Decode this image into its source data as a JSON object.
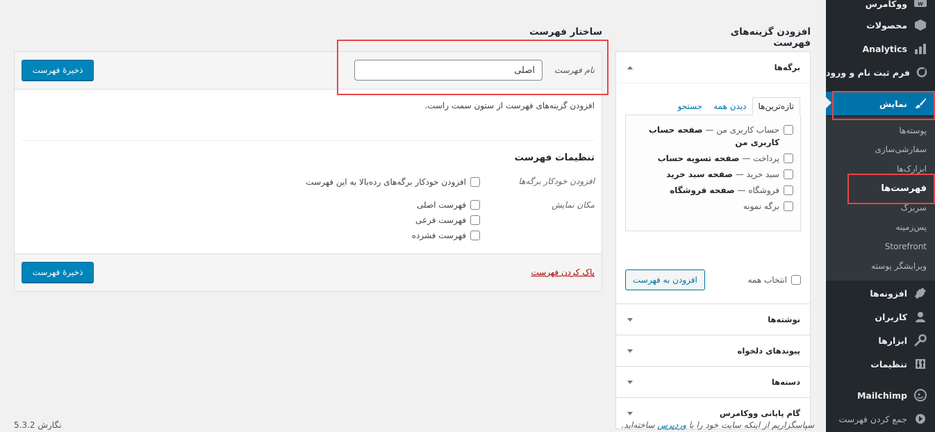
{
  "sidebar": {
    "items": [
      {
        "label": "ووکامرس",
        "icon": "woo-icon",
        "current": false
      },
      {
        "label": "محصولات",
        "icon": "box-icon",
        "current": false
      },
      {
        "label": "Analytics",
        "icon": "bar-chart-icon",
        "current": false
      },
      {
        "label": "فرم ثبت نام و ورود",
        "icon": "circle-icon",
        "current": false
      },
      {
        "label": "نمایش",
        "icon": "paintbrush-icon",
        "current": true
      },
      {
        "label": "افزونه‌ها",
        "icon": "plugin-icon",
        "current": false
      },
      {
        "label": "کاربران",
        "icon": "users-icon",
        "current": false
      },
      {
        "label": "ابزارها",
        "icon": "wrench-icon",
        "current": false
      },
      {
        "label": "تنظیمات",
        "icon": "settings-icon",
        "current": false
      },
      {
        "label": "Mailchimp",
        "icon": "mailchimp-icon",
        "current": false
      },
      {
        "label": "جمع کردن فهرست",
        "icon": "collapse-icon",
        "current": false
      }
    ],
    "submenu": [
      {
        "label": "پوسته‌ها",
        "active": false
      },
      {
        "label": "سفارشی‌سازی",
        "active": false
      },
      {
        "label": "ابزارک‌ها",
        "active": false
      },
      {
        "label": "فهرست‌ها",
        "active": true
      },
      {
        "label": "سربرگ",
        "active": false
      },
      {
        "label": "پس‌زمینه",
        "active": false
      },
      {
        "label": "Storefront",
        "active": false
      },
      {
        "label": "ویرایشگر پوسته",
        "active": false
      }
    ]
  },
  "add_items": {
    "heading": "افزودن گزینه‌های فهرست",
    "pages_section": {
      "title": "برگه‌ها",
      "tabs": [
        "تازه‌ترین‌ها",
        "دیدن همه",
        "جستجو"
      ],
      "items": [
        {
          "prefix": "حساب کاربری من — ",
          "bold": "صفحه حساب کاربری من"
        },
        {
          "prefix": "پرداخت — ",
          "bold": "صفحه تسویه حساب"
        },
        {
          "prefix": "سبد خرید — ",
          "bold": "صفحه سبد خرید"
        },
        {
          "prefix": "فروشگاه — ",
          "bold": "صفحه فروشگاه"
        },
        {
          "prefix": "برگه نمونه",
          "bold": ""
        }
      ],
      "select_all": "انتخاب همه",
      "add_button": "افزودن به فهرست"
    },
    "collapsed_sections": [
      "نوشته‌ها",
      "پیوندهای دلخواه",
      "دسته‌ها",
      "گام پایانی ووکامرس"
    ]
  },
  "menu_structure": {
    "heading": "ساختار فهرست",
    "name_label": "نام فهرست",
    "name_value": "اصلی",
    "save_label": "ذخیرهٔ فهرست",
    "instructions": "افزودن گزینه‌های فهرست از ستون سمت راست.",
    "settings_title": "تنظیمات فهرست",
    "auto_add_label": "افزودن خودکار برگه‌ها",
    "auto_add_option": "افزودن خودکار برگه‌های رده‌بالا به این فهرست",
    "location_label": "مکان نمایش",
    "locations": [
      "فهرست اصلی",
      "فهرست فرعی",
      "فهرست فشرده"
    ],
    "delete_label": "پاک کردن فهرست"
  },
  "footer": {
    "thanks_before": "سپاسگزاریم از اینکه سایت خود را با ",
    "thanks_link": "وردپرس",
    "thanks_after": " ساخته‌اید.",
    "version": "نگارش 5.3.2"
  },
  "colors": {
    "accent": "#0073aa",
    "highlight": "#e8454a",
    "sidebar": "#23282d"
  }
}
